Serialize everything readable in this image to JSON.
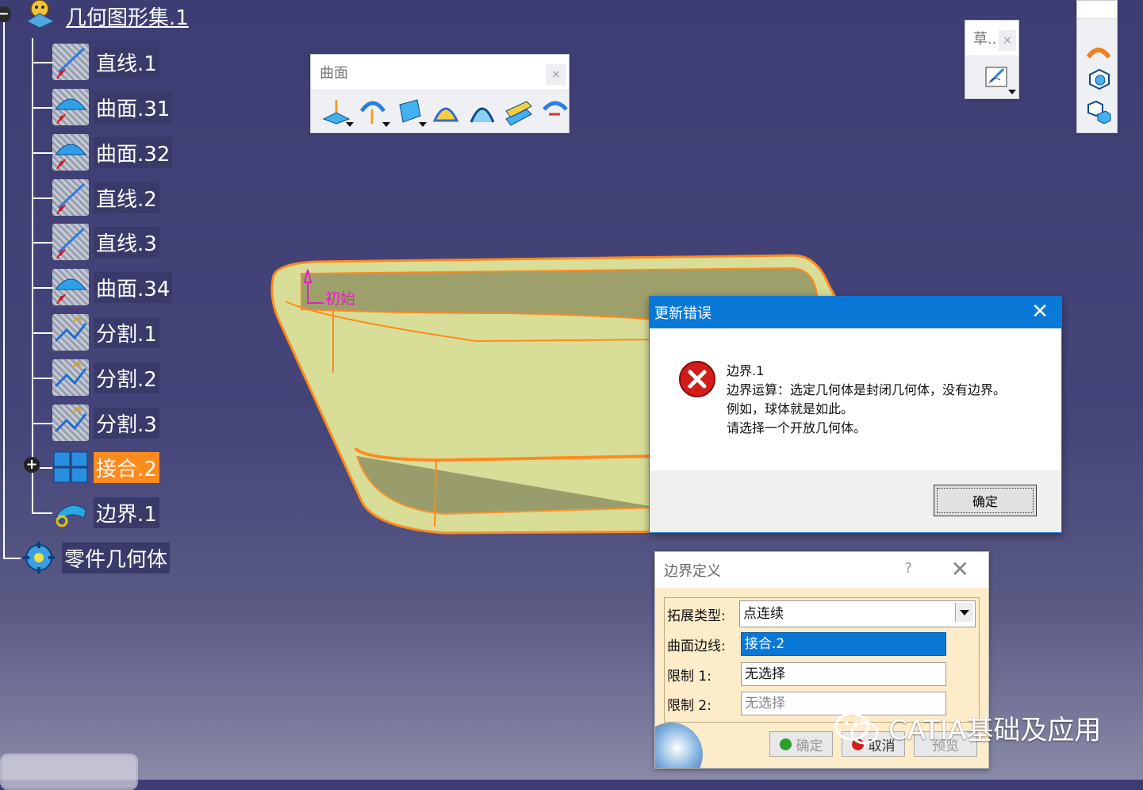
{
  "tree": {
    "root_label": "几何图形集.1",
    "items": [
      {
        "label": "直线.1",
        "icon": "line-icon"
      },
      {
        "label": "曲面.31",
        "icon": "surface-icon"
      },
      {
        "label": "曲面.32",
        "icon": "surface-icon"
      },
      {
        "label": "直线.2",
        "icon": "line-icon"
      },
      {
        "label": "直线.3",
        "icon": "line-icon"
      },
      {
        "label": "曲面.34",
        "icon": "surface-icon"
      },
      {
        "label": "分割.1",
        "icon": "split-icon"
      },
      {
        "label": "分割.2",
        "icon": "split-icon"
      },
      {
        "label": "分割.3",
        "icon": "split-icon"
      },
      {
        "label": "接合.2",
        "icon": "join-icon"
      },
      {
        "label": "边界.1",
        "icon": "boundary-icon"
      }
    ],
    "part_body_label": "零件几何体"
  },
  "surface_toolbar": {
    "title": "曲面",
    "close": "×"
  },
  "sketch_toolbar": {
    "title": "草..",
    "close": "×"
  },
  "viewport": {
    "annotation": "初始"
  },
  "error_dialog": {
    "title": "更新错误",
    "close": "✕",
    "lines": [
      "边界.1",
      "边界运算：选定几何体是封闭几何体，没有边界。",
      "例如，球体就是如此。",
      "请选择一个开放几何体。"
    ],
    "ok_label": "确定"
  },
  "boundary_dialog": {
    "title": "边界定义",
    "help": "?",
    "close": "✕",
    "propagation_label": "拓展类型:",
    "propagation_value": "点连续",
    "edge_label": "曲面边线:",
    "edge_value": "接合.2",
    "limit1_label": "限制 1:",
    "limit1_value": "无选择",
    "limit2_label": "限制 2:",
    "limit2_value": "无选择",
    "ok_label": "确定",
    "cancel_label": "取消",
    "preview_label": "预览"
  },
  "watermark": {
    "text": "CATIA基础及应用"
  },
  "colors": {
    "background": "#3d3d73",
    "accent": "#ff8a1e",
    "title_blue": "#0a78d7",
    "shape_fill": "#d8de98"
  }
}
